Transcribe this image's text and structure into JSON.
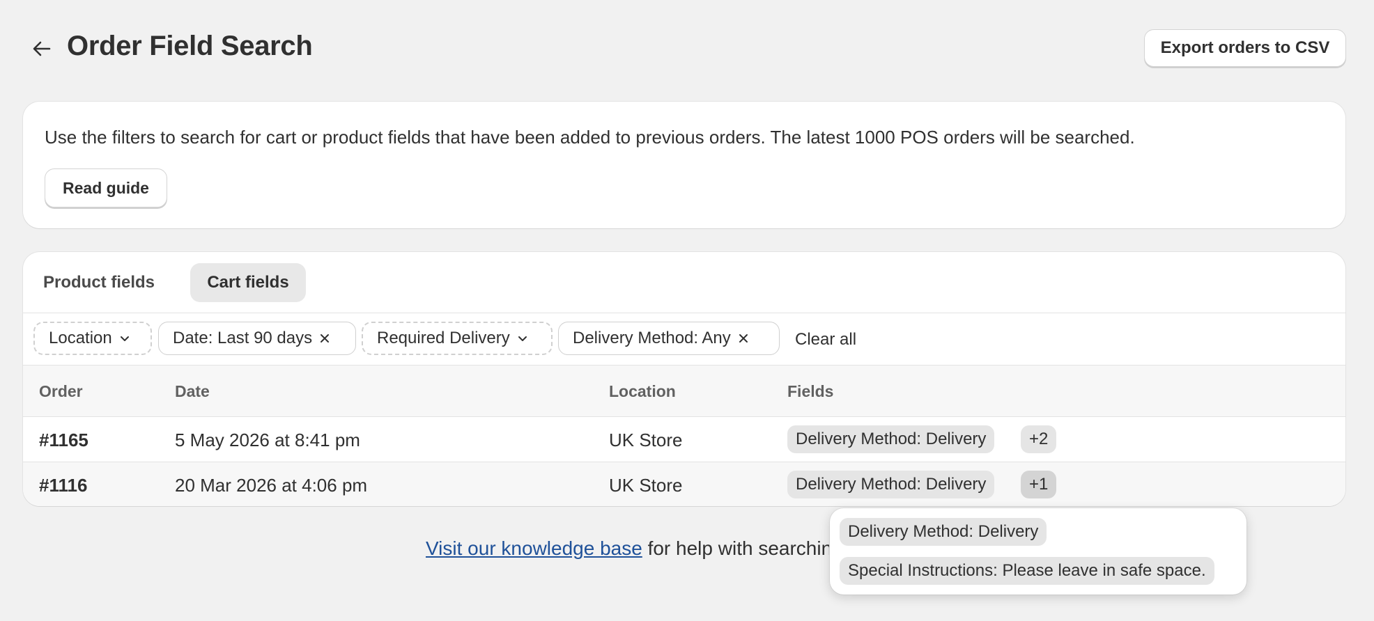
{
  "header": {
    "title": "Order Field Search",
    "back_icon": "arrow-left-icon",
    "export_label": "Export orders to CSV"
  },
  "info": {
    "text": "Use the filters to search for cart or product fields that have been added to previous orders. The latest 1000 POS orders will be searched.",
    "guide_label": "Read guide"
  },
  "tabs": [
    {
      "label": "Product fields",
      "selected": false
    },
    {
      "label": "Cart fields",
      "selected": true
    }
  ],
  "filters": {
    "location": "Location",
    "date": "Date: Last 90 days",
    "required": "Required Delivery",
    "delivery": "Delivery Method: Any",
    "clear_all": "Clear all"
  },
  "table": {
    "columns": [
      "Order",
      "Date",
      "Location",
      "Fields"
    ],
    "rows": [
      {
        "order": "#1165",
        "date": "5 May 2026 at 8:41 pm",
        "location": "UK Store",
        "field": "Delivery Method: Delivery",
        "more": "+2"
      },
      {
        "order": "#1116",
        "date": "20 Mar 2026 at 4:06 pm",
        "location": "UK Store",
        "field": "Delivery Method: Delivery",
        "more": "+1"
      }
    ]
  },
  "help": {
    "link": "Visit our knowledge base",
    "text": " for help with searching"
  },
  "popover": {
    "items": [
      "Delivery Method: Delivery",
      "Special Instructions: Please leave in safe space."
    ]
  },
  "colors": {
    "background": "#f1f1f1",
    "link": "#1f5199",
    "tag_bg": "#e5e5e5"
  }
}
